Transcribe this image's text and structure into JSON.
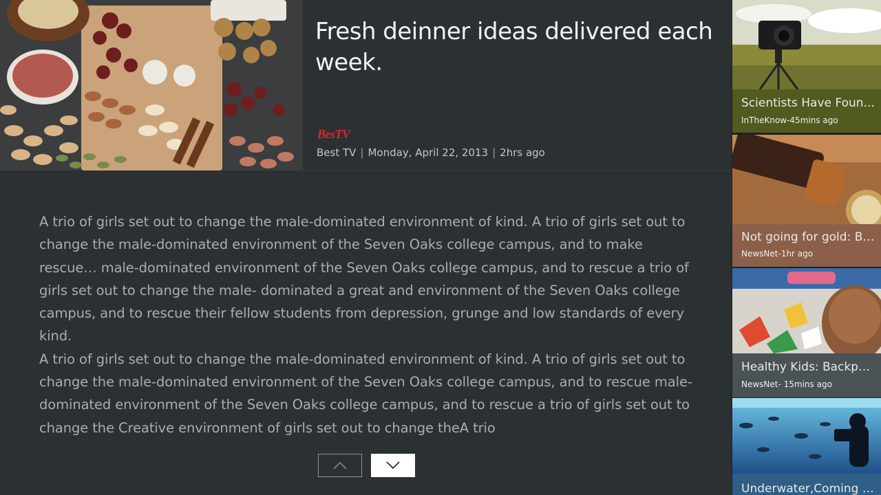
{
  "article": {
    "headline": "Fresh deinner ideas delivered each week.",
    "source_logo": "BesTV",
    "source": "Best TV",
    "date": "Monday, April 22, 2013",
    "age": "2hrs ago",
    "paragraphs": [
      "A trio of girls set out to change the male-dominated environment of kind. A trio of girls set out to change the male-dominated environment of the Seven Oaks college campus, and to make rescue… male-dominated environment of the Seven Oaks college campus, and to rescue a trio of girls set out to change the male- dominated a great and environment of the Seven Oaks college campus, and to rescue their fellow students from depression, grunge and low standards of every kind.",
      "A trio of girls set out to change the male-dominated environment of kind. A trio of girls set out to change the male-dominated environment of the Seven Oaks college campus, and to rescue male-dominated environment of the Seven Oaks college campus, and to rescue a trio of girls set out to change the Creative environment of girls set out to change theA trio"
    ],
    "image_icon": "food-collage-image"
  },
  "paging": {
    "up_icon": "chevron-up-icon",
    "down_icon": "chevron-down-icon"
  },
  "related": [
    {
      "title": "Scientists Have Foun...",
      "meta": "InTheKnow-45mins ago",
      "caption_color": "#535a1f",
      "image": "camera-on-tripod-image"
    },
    {
      "title": "Not going for gold: British",
      "meta": "NewsNet-1hr ago",
      "caption_color": "#8c5f4a",
      "image": "telescope-compass-image"
    },
    {
      "title": "Healthy Kids: Backpack S...",
      "meta": "NewsNet- 15mins ago",
      "caption_color": "#4a5256",
      "image": "kids-crafts-image"
    },
    {
      "title": "Underwater,Coming soo...",
      "meta": "",
      "caption_color": "#2f5e86",
      "image": "underwater-diver-image"
    }
  ]
}
